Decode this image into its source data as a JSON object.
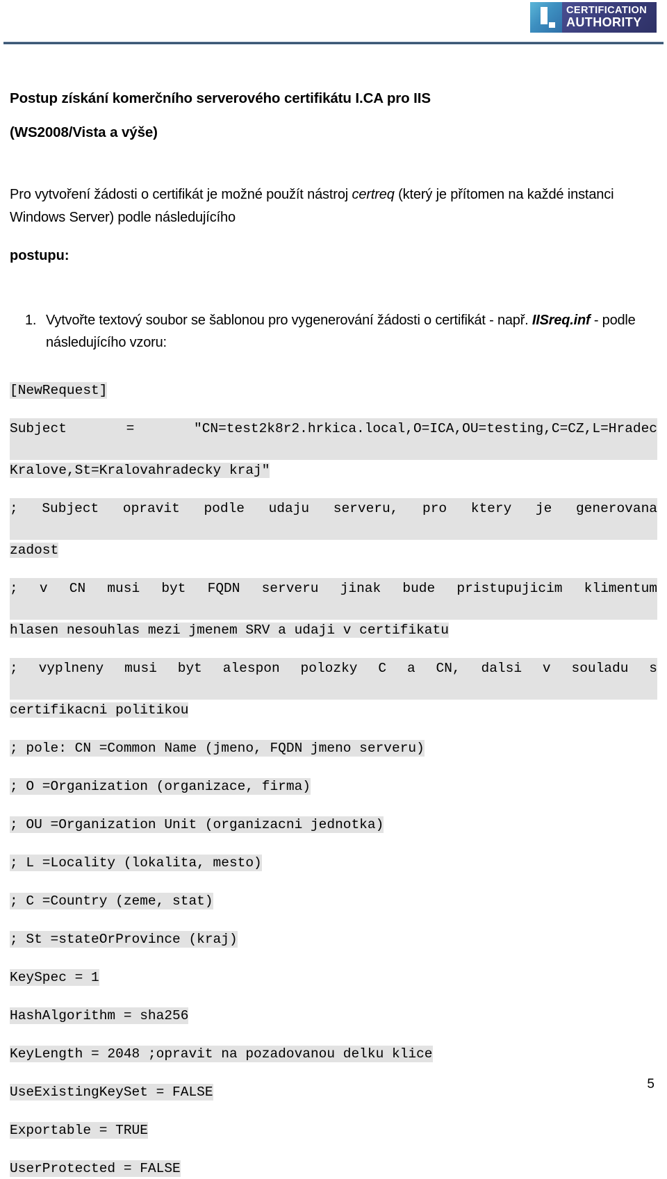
{
  "header": {
    "logo": {
      "mark_text": "I.",
      "line1": "CERTIFICATION",
      "line2": "AUTHORITY",
      "mark_color": "#3d8fc0",
      "text_block_color": "#3c3f7d"
    },
    "rule_color": "#2d4a68"
  },
  "title": {
    "line1": "Postup získání komerčního serverového certifikátu I.CA pro IIS",
    "line2": "(WS2008/Vista a výše)"
  },
  "intro": {
    "part1": "Pro vytvoření žádosti o certifikát je možné použít nástroj ",
    "tool_name": "certreq",
    "part2": " (který je přítomen na každé instanci Windows Server) podle následujícího",
    "postupu": "postupu:"
  },
  "steps": [
    {
      "number": "1.",
      "text_before": "Vytvořte textový soubor se šablonou pro vygenerování žádosti o certifikát - např. ",
      "filename": "IISreq.inf",
      "text_after": " - podle následujícího vzoru:"
    }
  ],
  "code": {
    "lines": [
      {
        "id": "new-request",
        "text": "[NewRequest]",
        "wrap": false
      },
      {
        "id": "subject",
        "text": "Subject = \"CN=test2k8r2.hrkica.local,O=ICA,OU=testing,C=CZ,L=Hradec Kralove,St=Kralovahradecky kraj\"",
        "wrap": true,
        "seg_a": "Subject = \"CN=test2k8r2.hrkica.local,O=ICA,OU=testing,C=CZ,L=Hradec",
        "seg_b": "Kralove,St=Kralovahradecky kraj\""
      },
      {
        "id": "comment-subject-opravit",
        "text": "; Subject opravit podle udaju serveru, pro ktery je generovana zadost",
        "wrap": true,
        "seg_a": "; Subject opravit podle udaju serveru, pro ktery je generovana",
        "seg_b": "zadost"
      },
      {
        "id": "comment-cn-fqdn",
        "text": "; v CN musi byt FQDN serveru jinak bude pristupujicim klimentum hlasen nesouhlas mezi jmenem SRV a udaji v certifikatu",
        "wrap": true,
        "seg_a": "; v CN musi byt FQDN serveru jinak bude pristupujicim klimentum",
        "seg_b": "hlasen nesouhlas mezi jmenem SRV a udaji v certifikatu"
      },
      {
        "id": "comment-vyplneny",
        "text": "; vyplneny musi byt alespon polozky C a CN, dalsi v souladu s certifikacni politikou",
        "wrap": true,
        "seg_a": "; vyplneny musi byt alespon polozky C a CN, dalsi v souladu s",
        "seg_b": "certifikacni politikou"
      },
      {
        "id": "comment-pole-cn",
        "text": "; pole: CN =Common Name (jmeno, FQDN jmeno serveru)",
        "wrap": false
      },
      {
        "id": "comment-o",
        "text": "; O =Organization (organizace, firma)",
        "wrap": false
      },
      {
        "id": "comment-ou",
        "text": "; OU =Organization Unit (organizacni jednotka)",
        "wrap": false
      },
      {
        "id": "comment-l",
        "text": "; L =Locality (lokalita, mesto)",
        "wrap": false
      },
      {
        "id": "comment-c",
        "text": "; C =Country (zeme, stat)",
        "wrap": false
      },
      {
        "id": "comment-st",
        "text": "; St =stateOrProvince (kraj)",
        "wrap": false
      },
      {
        "id": "keyspec",
        "text": "KeySpec = 1",
        "wrap": false
      },
      {
        "id": "hashalgorithm",
        "text": "HashAlgorithm = sha256",
        "wrap": false
      },
      {
        "id": "keylength",
        "text": "KeyLength = 2048 ;opravit na pozadovanou delku klice",
        "wrap": false
      },
      {
        "id": "useexistingkeyset",
        "text": "UseExistingKeySet = FALSE",
        "wrap": false
      },
      {
        "id": "exportable",
        "text": "Exportable = TRUE",
        "wrap": false
      },
      {
        "id": "userprotected",
        "text": "UserProtected = FALSE",
        "wrap": false
      }
    ],
    "highlight_color": "#e2e2e2"
  },
  "footer": {
    "page_number": "5"
  }
}
